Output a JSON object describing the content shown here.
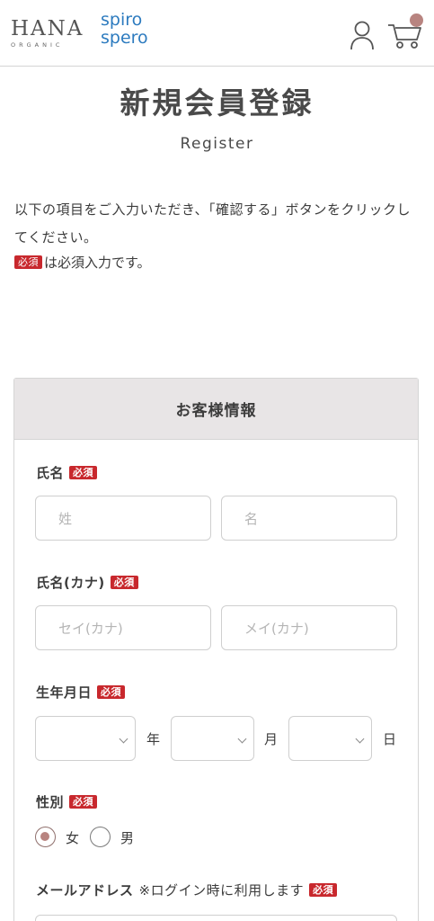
{
  "header": {
    "logo_hana": "HANA",
    "logo_hana_sub": "ORGANIC",
    "logo_spiro_line1": "spiro",
    "logo_spiro_line2": "spero",
    "user_icon": "user-icon",
    "cart_icon": "cart-icon"
  },
  "page": {
    "title": "新規会員登録",
    "subtitle": "Register",
    "intro": "以下の項目をご入力いただき、「確認する」ボタンをクリックしてください。",
    "required_badge": "必須",
    "required_note": "は必須入力です。"
  },
  "form": {
    "section_title": "お客様情報",
    "name": {
      "label": "氏名",
      "badge": "必須",
      "last_placeholder": "姓",
      "first_placeholder": "名"
    },
    "kana": {
      "label": "氏名(カナ)",
      "badge": "必須",
      "last_placeholder": "セイ(カナ)",
      "first_placeholder": "メイ(カナ)"
    },
    "birthday": {
      "label": "生年月日",
      "badge": "必須",
      "year_unit": "年",
      "month_unit": "月",
      "day_unit": "日",
      "year_value": "",
      "month_value": "",
      "day_value": ""
    },
    "gender": {
      "label": "性別",
      "badge": "必須",
      "options": [
        {
          "label": "女",
          "selected": true
        },
        {
          "label": "男",
          "selected": false
        }
      ]
    },
    "email": {
      "label": "メールアドレス",
      "note": "※ログイン時に利用します",
      "badge": "必須"
    }
  },
  "colors": {
    "brand_blue": "#2d7bbf",
    "required_red": "#c8282d",
    "accent_rose": "#b88480",
    "section_bg": "#e8e5e6"
  }
}
